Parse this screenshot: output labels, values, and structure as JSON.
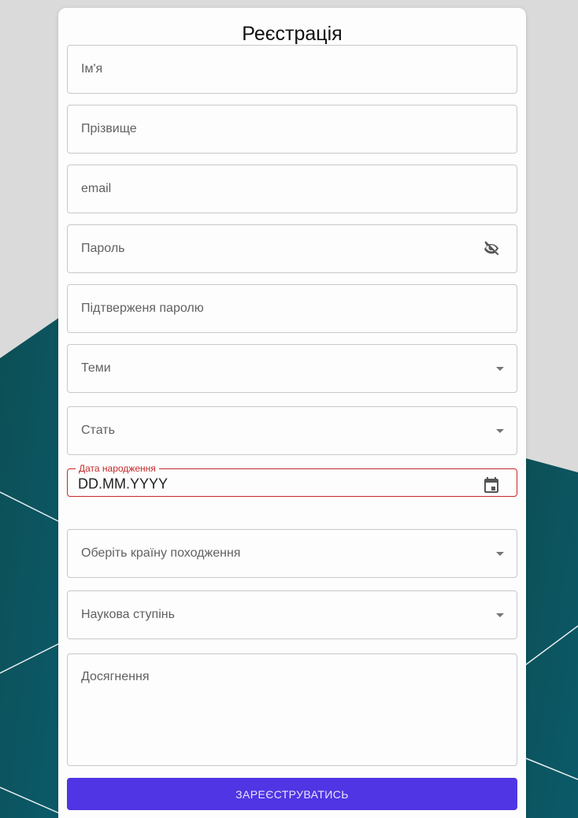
{
  "form": {
    "title": "Реєстрація",
    "first_name_placeholder": "Ім'я",
    "last_name_placeholder": "Прізвище",
    "email_placeholder": "email",
    "password_placeholder": "Пароль",
    "password_confirm_placeholder": "Підтверженя паролю",
    "topics_placeholder": "Теми",
    "gender_placeholder": "Стать",
    "birthdate_label": "Дата народження",
    "birthdate_value": "DD.MM.YYYY",
    "country_placeholder": "Оберіть країну походження",
    "degree_placeholder": "Наукова ступінь",
    "achievements_placeholder": "Досягнення",
    "submit_label": "ЗАРЕЄСТРУВАТИСЬ"
  },
  "icons": {
    "password_toggle": "eye-off-icon",
    "date_picker": "calendar-icon",
    "dropdown": "chevron-down-icon"
  },
  "colors": {
    "accent": "#4f35e3",
    "error": "#c62828",
    "background_teal": "#0f5a63"
  }
}
